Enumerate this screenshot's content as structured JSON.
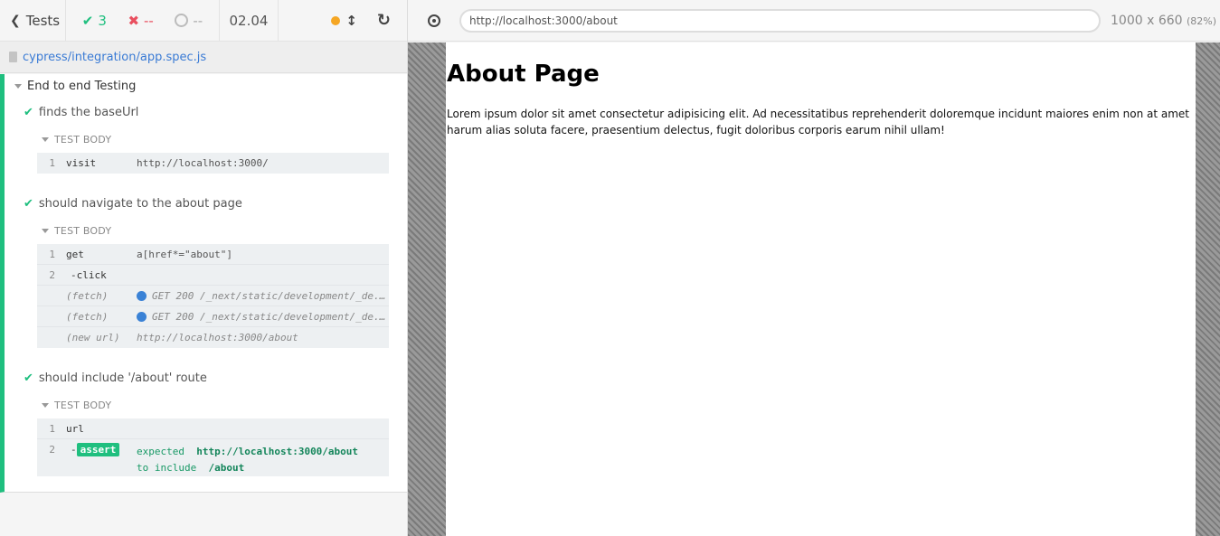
{
  "reporter": {
    "header": {
      "tests_label": "Tests",
      "passed": "3",
      "failed": "--",
      "pending": "--",
      "duration": "02.04"
    },
    "spec_path": "cypress/integration/app.spec.js",
    "suite_title": "End to end Testing",
    "test_body_label": "TEST BODY",
    "tests": [
      {
        "title": "finds the baseUrl",
        "commands": [
          {
            "num": "1",
            "name": "visit",
            "message": "http://localhost:3000/"
          }
        ]
      },
      {
        "title": "should navigate to the about page",
        "commands": [
          {
            "num": "1",
            "name": "get",
            "message": "a[href*=\"about\"]"
          },
          {
            "num": "2",
            "name": "-click",
            "message": ""
          },
          {
            "name": "(fetch)",
            "message": "GET 200 /_next/static/development/_de..."
          },
          {
            "name": "(fetch)",
            "message": "GET 200 /_next/static/development/_de..."
          },
          {
            "name": "(new url)",
            "message": "http://localhost:3000/about"
          }
        ]
      },
      {
        "title": "should include '/about' route",
        "commands": [
          {
            "num": "1",
            "name": "url",
            "message": ""
          },
          {
            "num": "2",
            "name": "-",
            "badge": "assert",
            "message_parts": [
              "expected",
              "http://localhost:3000/about",
              "to",
              "include",
              "/about"
            ]
          }
        ]
      }
    ]
  },
  "aut": {
    "url": "http://localhost:3000/about",
    "viewport_size": "1000 x 660",
    "scale": "(82%)",
    "page": {
      "heading": "About Page",
      "body": "Lorem ipsum dolor sit amet consectetur adipisicing elit. Ad necessitatibus reprehenderit doloremque incidunt maiores enim non at amet harum alias soluta facere, praesentium delectus, fugit doloribus corporis earum nihil ullam!"
    }
  },
  "colors": {
    "pass": "#1fbf7f",
    "fail": "#e94f5f",
    "link": "#3a7bd5",
    "xhr": "#3a82d6",
    "running": "#f5a623"
  },
  "icons": [
    "chevron-left-icon",
    "check-icon",
    "x-icon",
    "spinner-icon",
    "dot-icon",
    "resize-icon",
    "reload-icon",
    "file-icon",
    "crosshair-icon"
  ]
}
